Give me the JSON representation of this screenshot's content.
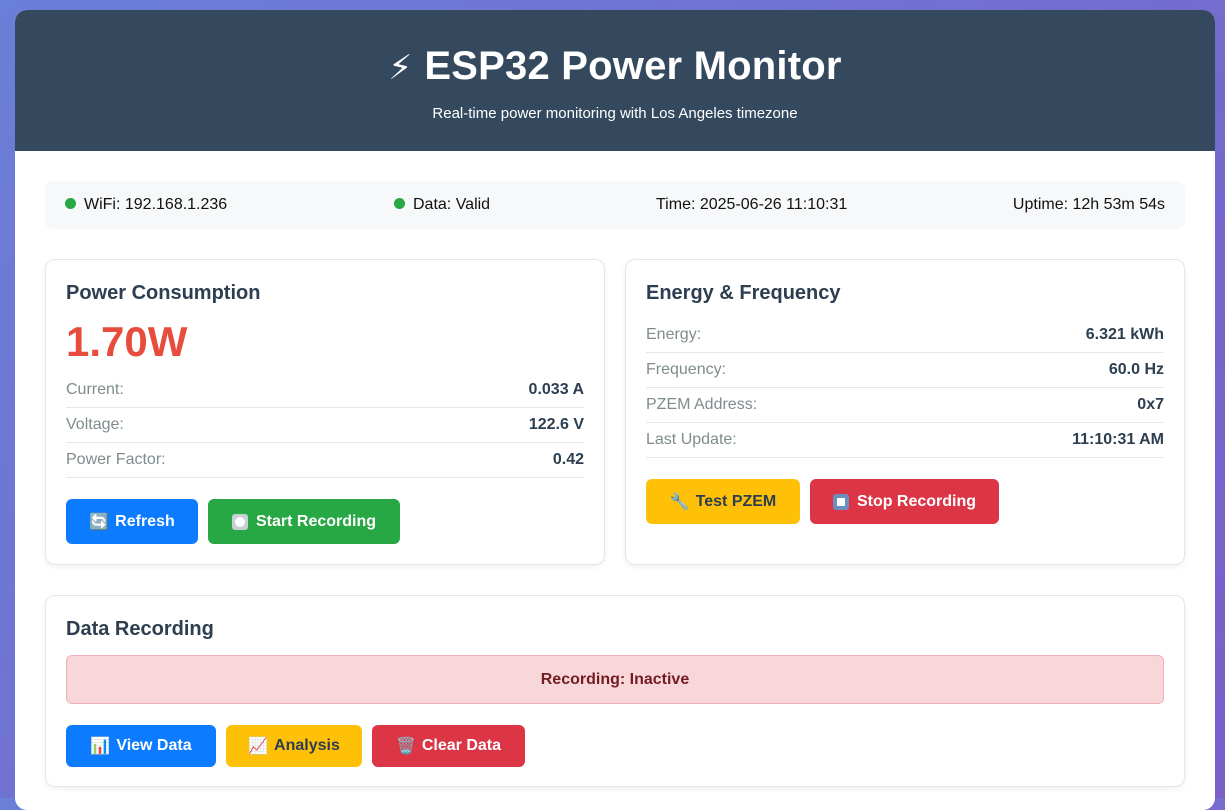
{
  "header": {
    "icon": "lightning-bolt-icon",
    "bolt_glyph": "⚡",
    "title": "ESP32 Power Monitor",
    "subtitle": "Real-time power monitoring with Los Angeles timezone"
  },
  "status": {
    "wifi": "WiFi: 192.168.1.236",
    "data": "Data: Valid",
    "time": "Time: 2025-06-26 11:10:31",
    "uptime": "Uptime: 12h 53m 54s",
    "ok_color": "#28a745"
  },
  "power_card": {
    "title": "Power Consumption",
    "power": "1.70W",
    "rows": [
      {
        "label": "Current:",
        "value": "0.033 A"
      },
      {
        "label": "Voltage:",
        "value": "122.6 V"
      },
      {
        "label": "Power Factor:",
        "value": "0.42"
      }
    ],
    "refresh_label": "Refresh",
    "refresh_icon": "🔄",
    "start_label": "Start Recording"
  },
  "energy_card": {
    "title": "Energy & Frequency",
    "rows": [
      {
        "label": "Energy:",
        "value": "6.321 kWh"
      },
      {
        "label": "Frequency:",
        "value": "60.0 Hz"
      },
      {
        "label": "PZEM Address:",
        "value": "0x7"
      },
      {
        "label": "Last Update:",
        "value": "11:10:31 AM"
      }
    ],
    "test_label": "Test PZEM",
    "test_icon": "🔧",
    "stop_label": "Stop Recording"
  },
  "recording_card": {
    "title": "Data Recording",
    "status": "Recording: Inactive",
    "view_label": "View Data",
    "view_icon": "📊",
    "analysis_label": "Analysis",
    "analysis_icon": "📈",
    "clear_label": "Clear Data",
    "clear_icon": "🗑️"
  },
  "colors": {
    "header_bg": "#34495e",
    "power_value": "#e74c3c",
    "primary": "#0d7bff",
    "success": "#28a745",
    "warning": "#ffc107",
    "danger": "#dc3545"
  }
}
